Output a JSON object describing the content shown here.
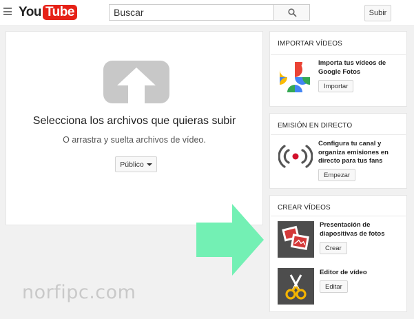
{
  "header": {
    "logo_you": "You",
    "logo_tube": "Tube",
    "search_placeholder": "Buscar",
    "upload_label": "Subir"
  },
  "main": {
    "title": "Selecciona los archivos que quieras subir",
    "subtitle": "O arrastra y suelta archivos de vídeo.",
    "privacy_label": "Público"
  },
  "import_card": {
    "title": "IMPORTAR VÍDEOS",
    "text_line1": "Importa tus vídeos de",
    "text_line2": "Google Fotos",
    "button": "Importar"
  },
  "live_card": {
    "title": "EMISIÓN EN DIRECTO",
    "text_line1": "Configura tu canal y",
    "text_line2": "organiza emisiones en",
    "text_line3": "directo para tus fans",
    "button": "Empezar"
  },
  "create_card": {
    "title": "CREAR VÍDEOS",
    "slideshow_line1": "Presentación de",
    "slideshow_line2": "diapositivas de fotos",
    "slideshow_button": "Crear",
    "editor_label": "Editor de vídeo",
    "editor_button": "Editar"
  },
  "watermark": "norfipc.com",
  "colors": {
    "brand_red": "#e62117",
    "arrow_green": "#73f0b4",
    "upload_graphic": "#c8c8c8",
    "live_red": "#d2112c",
    "thumb_bg": "#4d4d4d"
  }
}
